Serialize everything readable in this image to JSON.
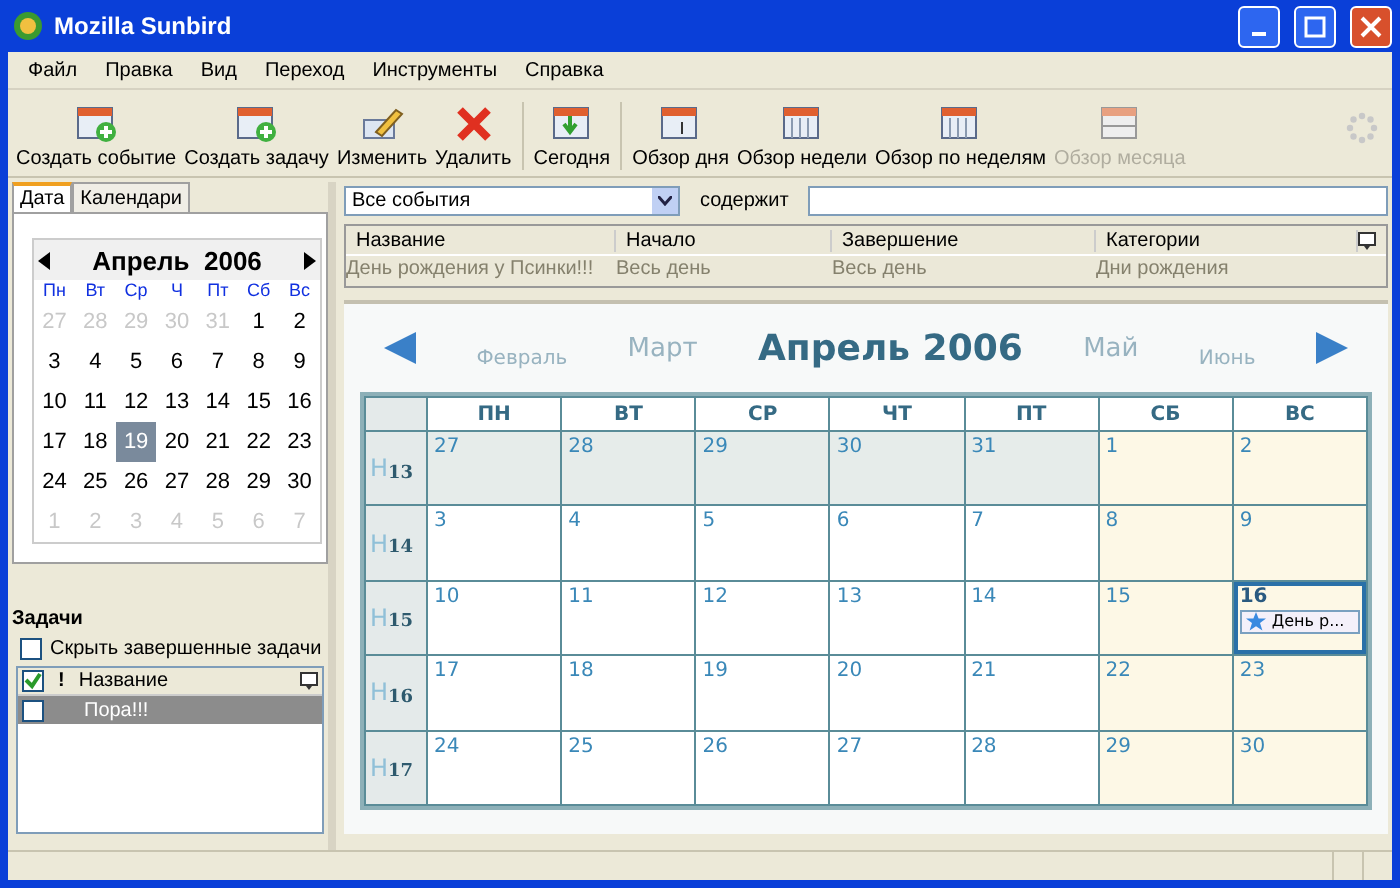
{
  "window": {
    "title": "Mozilla Sunbird"
  },
  "menu": [
    "Файл",
    "Правка",
    "Вид",
    "Переход",
    "Инструменты",
    "Справка"
  ],
  "toolbar": [
    {
      "label": "Создать событие",
      "kind": "new-event",
      "disabled": false
    },
    {
      "label": "Создать задачу",
      "kind": "new-task",
      "disabled": false
    },
    {
      "label": "Изменить",
      "kind": "edit",
      "disabled": false
    },
    {
      "label": "Удалить",
      "kind": "delete",
      "disabled": false
    },
    {
      "label": "Сегодня",
      "kind": "today",
      "disabled": false
    },
    {
      "label": "Обзор дня",
      "kind": "day",
      "disabled": false
    },
    {
      "label": "Обзор недели",
      "kind": "week",
      "disabled": false
    },
    {
      "label": "Обзор по неделям",
      "kind": "multiweek",
      "disabled": false
    },
    {
      "label": "Обзор месяца",
      "kind": "month",
      "disabled": true
    }
  ],
  "sidebar": {
    "tabs": [
      {
        "label": "Дата",
        "selected": true
      },
      {
        "label": "Календари",
        "selected": false
      }
    ],
    "minical": {
      "title": "Апрель  2006",
      "weekdays": [
        "Пн",
        "Вт",
        "Ср",
        "Ч",
        "Пт",
        "Сб",
        "Вс"
      ],
      "days": [
        {
          "label": "27",
          "muted": true,
          "selected": false
        },
        {
          "label": "28",
          "muted": true,
          "selected": false
        },
        {
          "label": "29",
          "muted": true,
          "selected": false
        },
        {
          "label": "30",
          "muted": true,
          "selected": false
        },
        {
          "label": "31",
          "muted": true,
          "selected": false
        },
        {
          "label": "1",
          "muted": false,
          "selected": false
        },
        {
          "label": "2",
          "muted": false,
          "selected": false
        },
        {
          "label": "3",
          "muted": false,
          "selected": false
        },
        {
          "label": "4",
          "muted": false,
          "selected": false
        },
        {
          "label": "5",
          "muted": false,
          "selected": false
        },
        {
          "label": "6",
          "muted": false,
          "selected": false
        },
        {
          "label": "7",
          "muted": false,
          "selected": false
        },
        {
          "label": "8",
          "muted": false,
          "selected": false
        },
        {
          "label": "9",
          "muted": false,
          "selected": false
        },
        {
          "label": "10",
          "muted": false,
          "selected": false
        },
        {
          "label": "11",
          "muted": false,
          "selected": false
        },
        {
          "label": "12",
          "muted": false,
          "selected": false
        },
        {
          "label": "13",
          "muted": false,
          "selected": false
        },
        {
          "label": "14",
          "muted": false,
          "selected": false
        },
        {
          "label": "15",
          "muted": false,
          "selected": false
        },
        {
          "label": "16",
          "muted": false,
          "selected": false
        },
        {
          "label": "17",
          "muted": false,
          "selected": false
        },
        {
          "label": "18",
          "muted": false,
          "selected": false
        },
        {
          "label": "19",
          "muted": false,
          "selected": true
        },
        {
          "label": "20",
          "muted": false,
          "selected": false
        },
        {
          "label": "21",
          "muted": false,
          "selected": false
        },
        {
          "label": "22",
          "muted": false,
          "selected": false
        },
        {
          "label": "23",
          "muted": false,
          "selected": false
        },
        {
          "label": "24",
          "muted": false,
          "selected": false
        },
        {
          "label": "25",
          "muted": false,
          "selected": false
        },
        {
          "label": "26",
          "muted": false,
          "selected": false
        },
        {
          "label": "27",
          "muted": false,
          "selected": false
        },
        {
          "label": "28",
          "muted": false,
          "selected": false
        },
        {
          "label": "29",
          "muted": false,
          "selected": false
        },
        {
          "label": "30",
          "muted": false,
          "selected": false
        },
        {
          "label": "1",
          "muted": true,
          "selected": false
        },
        {
          "label": "2",
          "muted": true,
          "selected": false
        },
        {
          "label": "3",
          "muted": true,
          "selected": false
        },
        {
          "label": "4",
          "muted": true,
          "selected": false
        },
        {
          "label": "5",
          "muted": true,
          "selected": false
        },
        {
          "label": "6",
          "muted": true,
          "selected": false
        },
        {
          "label": "7",
          "muted": true,
          "selected": false
        }
      ]
    },
    "tasks": {
      "title": "Задачи",
      "hide_completed": {
        "label": "Скрыть завершенные задачи",
        "checked": false
      },
      "columns": [
        "!",
        "Название"
      ],
      "rows": [
        {
          "title": "Пора!!!",
          "done": false,
          "selected": true
        }
      ]
    }
  },
  "filter": {
    "value": "Все события",
    "contains_label": "содержит"
  },
  "events": {
    "columns": [
      "Название",
      "Начало",
      "Завершение",
      "Категории"
    ],
    "rows": [
      {
        "cells": [
          "День рождения у Псинки!!!",
          "Весь день",
          "Весь день",
          "Дни рождения"
        ]
      }
    ]
  },
  "month_view": {
    "months": [
      {
        "label": "Февраль",
        "kind": "far"
      },
      {
        "label": "Март",
        "kind": "near"
      },
      {
        "label": "Апрель 2006",
        "kind": "current"
      },
      {
        "label": "Май",
        "kind": "near"
      },
      {
        "label": "Июнь",
        "kind": "far"
      }
    ],
    "weekdays": [
      {
        "label": "ПН",
        "weekend": false
      },
      {
        "label": "ВТ",
        "weekend": false
      },
      {
        "label": "СР",
        "weekend": false
      },
      {
        "label": "ЧТ",
        "weekend": false
      },
      {
        "label": "ПТ",
        "weekend": false
      },
      {
        "label": "СБ",
        "weekend": true
      },
      {
        "label": "ВС",
        "weekend": true
      }
    ],
    "weeks": [
      {
        "mark": "H",
        "number": "13",
        "days": [
          {
            "label": "27",
            "other_month": true,
            "selected": false
          },
          {
            "label": "28",
            "other_month": true,
            "selected": false
          },
          {
            "label": "29",
            "other_month": true,
            "selected": false
          },
          {
            "label": "30",
            "other_month": true,
            "selected": false
          },
          {
            "label": "31",
            "other_month": true,
            "selected": false
          },
          {
            "label": "1",
            "other_month": false,
            "selected": false
          },
          {
            "label": "2",
            "other_month": false,
            "selected": false
          }
        ]
      },
      {
        "mark": "H",
        "number": "14",
        "days": [
          {
            "label": "3",
            "other_month": false,
            "selected": false
          },
          {
            "label": "4",
            "other_month": false,
            "selected": false
          },
          {
            "label": "5",
            "other_month": false,
            "selected": false
          },
          {
            "label": "6",
            "other_month": false,
            "selected": false
          },
          {
            "label": "7",
            "other_month": false,
            "selected": false
          },
          {
            "label": "8",
            "other_month": false,
            "selected": false
          },
          {
            "label": "9",
            "other_month": false,
            "selected": false
          }
        ]
      },
      {
        "mark": "H",
        "number": "15",
        "days": [
          {
            "label": "10",
            "other_month": false,
            "selected": false
          },
          {
            "label": "11",
            "other_month": false,
            "selected": false
          },
          {
            "label": "12",
            "other_month": false,
            "selected": false
          },
          {
            "label": "13",
            "other_month": false,
            "selected": false
          },
          {
            "label": "14",
            "other_month": false,
            "selected": false
          },
          {
            "label": "15",
            "other_month": false,
            "selected": false
          },
          {
            "label": "16",
            "other_month": false,
            "selected": true,
            "events": [
              "День р..."
            ]
          }
        ]
      },
      {
        "mark": "H",
        "number": "16",
        "days": [
          {
            "label": "17",
            "other_month": false,
            "selected": false
          },
          {
            "label": "18",
            "other_month": false,
            "selected": false
          },
          {
            "label": "19",
            "other_month": false,
            "selected": false
          },
          {
            "label": "20",
            "other_month": false,
            "selected": false
          },
          {
            "label": "21",
            "other_month": false,
            "selected": false
          },
          {
            "label": "22",
            "other_month": false,
            "selected": false
          },
          {
            "label": "23",
            "other_month": false,
            "selected": false
          }
        ]
      },
      {
        "mark": "H",
        "number": "17",
        "days": [
          {
            "label": "24",
            "other_month": false,
            "selected": false
          },
          {
            "label": "25",
            "other_month": false,
            "selected": false
          },
          {
            "label": "26",
            "other_month": false,
            "selected": false
          },
          {
            "label": "27",
            "other_month": false,
            "selected": false
          },
          {
            "label": "28",
            "other_month": false,
            "selected": false
          },
          {
            "label": "29",
            "other_month": false,
            "selected": false
          },
          {
            "label": "30",
            "other_month": false,
            "selected": false
          }
        ]
      }
    ]
  }
}
